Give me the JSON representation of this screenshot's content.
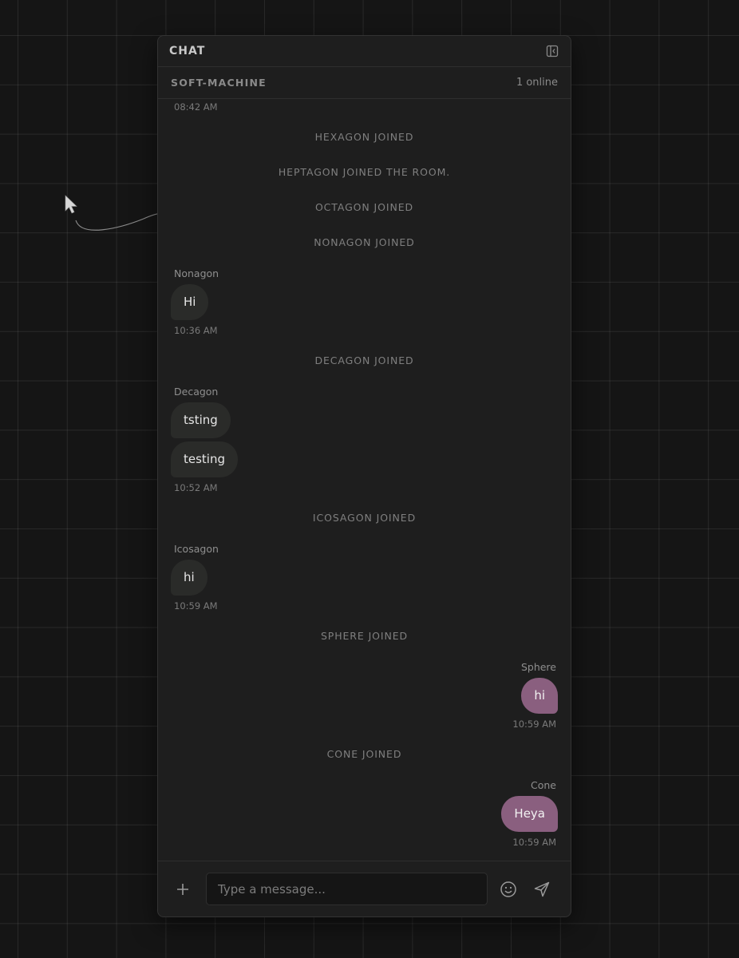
{
  "header": {
    "title": "CHAT"
  },
  "room": {
    "name": "SOFT-MACHINE",
    "online": "1 online"
  },
  "messages": [
    {
      "type": "timestamp",
      "text": "08:42 AM"
    },
    {
      "type": "system",
      "text": "HEXAGON JOINED"
    },
    {
      "type": "system",
      "text": "HEPTAGON JOINED THE ROOM."
    },
    {
      "type": "system",
      "text": "OCTAGON JOINED"
    },
    {
      "type": "system",
      "text": "NONAGON JOINED"
    },
    {
      "type": "group",
      "sender": "Nonagon",
      "mine": false,
      "bubbles": [
        "Hi"
      ],
      "time": "10:36 AM"
    },
    {
      "type": "system",
      "text": "DECAGON JOINED"
    },
    {
      "type": "group",
      "sender": "Decagon",
      "mine": false,
      "bubbles": [
        "tsting",
        "testing"
      ],
      "time": "10:52 AM"
    },
    {
      "type": "system",
      "text": "ICOSAGON JOINED"
    },
    {
      "type": "group",
      "sender": "Icosagon",
      "mine": false,
      "bubbles": [
        "hi"
      ],
      "time": "10:59 AM"
    },
    {
      "type": "system",
      "text": "SPHERE JOINED"
    },
    {
      "type": "group",
      "sender": "Sphere",
      "mine": true,
      "bubbles": [
        "hi"
      ],
      "time": "10:59 AM"
    },
    {
      "type": "system",
      "text": "CONE JOINED"
    },
    {
      "type": "group",
      "sender": "Cone",
      "mine": true,
      "bubbles": [
        "Heya"
      ],
      "time": "10:59 AM"
    }
  ],
  "composer": {
    "placeholder": "Type a message...",
    "add_icon": "plus-icon",
    "emoji_icon": "smiley-icon",
    "send_icon": "paper-plane-icon"
  },
  "colors": {
    "accent_bubble": "#8a5f7f",
    "other_bubble": "#2a2b29",
    "panel_bg": "#1e1e1e",
    "canvas_bg": "#151515"
  }
}
